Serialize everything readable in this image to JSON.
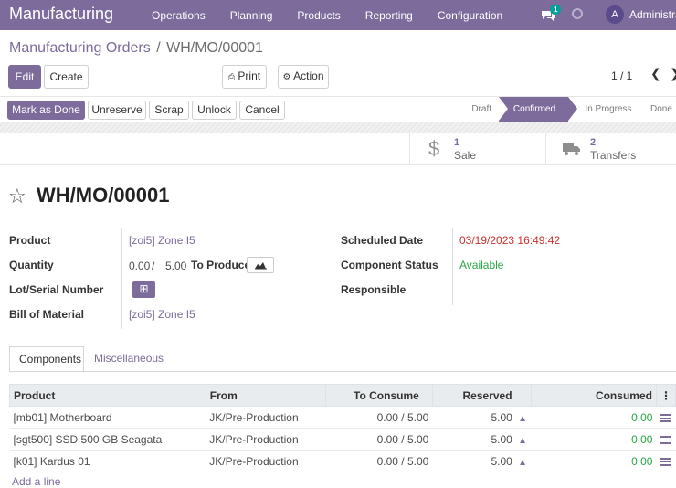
{
  "app": {
    "brand": "Manufacturing",
    "user": "Administrator",
    "chat_badge": "1"
  },
  "nav": {
    "items": [
      "Operations",
      "Planning",
      "Products",
      "Reporting",
      "Configuration"
    ]
  },
  "breadcrumb": {
    "parent": "Manufacturing Orders",
    "separator": "/",
    "current": "WH/MO/00001"
  },
  "toolbar": {
    "edit": "Edit",
    "create": "Create",
    "print": "Print",
    "action": "Action"
  },
  "pager": {
    "value": "1 / 1"
  },
  "statusbar": {
    "buttons": {
      "mark_done": "Mark as Done",
      "unreserve": "Unreserve",
      "scrap": "Scrap",
      "unlock": "Unlock",
      "cancel": "Cancel"
    },
    "stages": [
      {
        "label": "Draft",
        "active": false
      },
      {
        "label": "Confirmed",
        "active": true
      },
      {
        "label": "In Progress",
        "active": false
      },
      {
        "label": "Done",
        "active": false
      }
    ]
  },
  "smart_buttons": {
    "sale": {
      "count": "1",
      "label": "Sale"
    },
    "transfers": {
      "count": "2",
      "label": "Transfers"
    }
  },
  "record": {
    "title": "WH/MO/00001",
    "labels": {
      "product": "Product",
      "quantity": "Quantity",
      "lot": "Lot/Serial Number",
      "bom": "Bill of Material",
      "scheduled": "Scheduled Date",
      "component_status": "Component Status",
      "responsible": "Responsible"
    },
    "product": "[zoi5] Zone I5",
    "qty_done": "0.00",
    "qty_sep": "/",
    "qty_total": "5.00",
    "to_produce": "To Produce",
    "bom": "[zoi5] Zone I5",
    "scheduled_date": "03/19/2023 16:49:42",
    "component_status": "Available",
    "responsible": ""
  },
  "tabs": {
    "components": "Components",
    "misc": "Miscellaneous"
  },
  "components": {
    "headers": {
      "product": "Product",
      "from": "From",
      "to_consume": "To Consume",
      "reserved": "Reserved",
      "consumed": "Consumed"
    },
    "rows": [
      {
        "product": "[mb01] Motherboard",
        "from": "JK/Pre-Production",
        "to_consume": "0.00 / 5.00",
        "reserved": "5.00",
        "consumed": "0.00"
      },
      {
        "product": "[sgt500] SSD 500 GB Seagata",
        "from": "JK/Pre-Production",
        "to_consume": "0.00 / 5.00",
        "reserved": "5.00",
        "consumed": "0.00"
      },
      {
        "product": "[k01] Kardus 01",
        "from": "JK/Pre-Production",
        "to_consume": "0.00 / 5.00",
        "reserved": "5.00",
        "consumed": "0.00"
      }
    ],
    "add_line": "Add a line"
  }
}
